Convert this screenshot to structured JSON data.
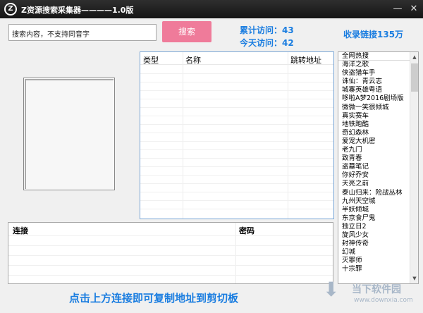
{
  "app": {
    "logo": "Z",
    "title": "Z资源搜索采集器————1.0版",
    "minimize_icon": "minimize-icon",
    "close_icon": "close-icon"
  },
  "search": {
    "input_value": "搜索内容，不支持同音字",
    "button_label": "搜索"
  },
  "stats": {
    "total_visits": "累计访问：43",
    "today_visits": "今天访问：42",
    "collected_links": "收录链接135万"
  },
  "results": {
    "columns": [
      "类型",
      "名称",
      "跳转地址"
    ],
    "rows": []
  },
  "hot_list": {
    "header": "全网热搜",
    "items": [
      "海洋之歌",
      "侠盗猎车手",
      "诛仙：青云志",
      "城寨英雄粤语",
      "哆啦A梦2016剧场版",
      "微微一笑很倾城",
      "真实赛车",
      "地铁跑酷",
      "奇幻森林",
      "爱宠大机密",
      "老九门",
      "致青春",
      "盗墓笔记",
      "你好乔安",
      "天亮之前",
      "泰山归来：险战丛林",
      "九州天空城",
      "半妖倾城",
      "东京食尸鬼",
      "独立日2",
      "旋风少女",
      "封神传奇",
      "幻城",
      "灭罪师",
      "十宗罪"
    ]
  },
  "connection": {
    "columns": [
      "连接",
      "密码"
    ],
    "rows": []
  },
  "footer_text": "点击上方连接即可复制地址到剪切板",
  "watermark": {
    "text": "当下软件园",
    "url": "www.downxia.com"
  },
  "colors": {
    "accent_blue": "#1a7de0",
    "search_button": "#ef7b9a",
    "titlebar": "#1f1f1f"
  }
}
